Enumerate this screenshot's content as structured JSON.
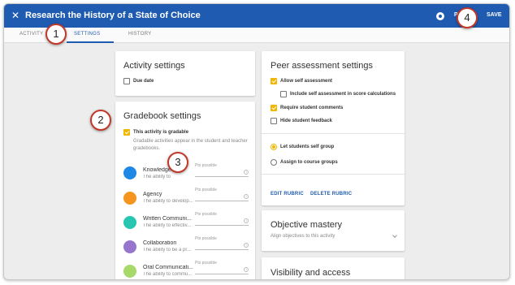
{
  "header": {
    "title": "Research the History of a State of Choice",
    "close_glyph": "✕",
    "preview_label": "PR",
    "save_label": "SAVE",
    "color": "#1f5bb0"
  },
  "tabs": [
    {
      "label": "ACTIVITY"
    },
    {
      "label": "SETTINGS",
      "active": true
    },
    {
      "label": "HISTORY"
    }
  ],
  "activity_settings": {
    "title": "Activity settings",
    "due_date_label": "Due date",
    "due_date_checked": false
  },
  "gradebook_settings": {
    "title": "Gradebook settings",
    "gradable_label": "This activity is gradable",
    "gradable_checked": true,
    "gradable_help": [
      "Gradable activities appear in the student and teacher",
      "gradebooks."
    ],
    "pts_label": "Pts possible",
    "competencies": [
      {
        "name": "Knowledge",
        "desc": "The ability to",
        "color": "#1e88e5"
      },
      {
        "name": "Agency",
        "desc": "The ability to develop...",
        "color": "#f7941d"
      },
      {
        "name": "Written Communi...",
        "desc": "The ability to effectiv...",
        "color": "#26c6b0"
      },
      {
        "name": "Collaboration",
        "desc": "The ability to be a pr...",
        "color": "#9575cd"
      },
      {
        "name": "Oral Communicati...",
        "desc": "The ability to commu...",
        "color": "#a6d96a"
      }
    ]
  },
  "peer_assessment": {
    "title": "Peer assessment settings",
    "options": [
      {
        "label": "Allow self assessment",
        "checked": true,
        "indent": false
      },
      {
        "label": "Include self assessment in score calculations",
        "checked": false,
        "indent": true
      },
      {
        "label": "Require student comments",
        "checked": true,
        "indent": false
      },
      {
        "label": "Hide student feedback",
        "checked": false,
        "indent": false
      }
    ],
    "grouping": [
      {
        "label": "Let students self group",
        "selected": true
      },
      {
        "label": "Assign to course groups",
        "selected": false
      }
    ],
    "edit_rubric_label": "EDIT RUBRIC",
    "delete_rubric_label": "DELETE RUBRIC"
  },
  "objective_mastery": {
    "title": "Objective mastery",
    "subtitle": "Align objectives to this activity"
  },
  "visibility": {
    "title": "Visibility and access"
  },
  "callouts": [
    "1",
    "2",
    "3",
    "4"
  ]
}
